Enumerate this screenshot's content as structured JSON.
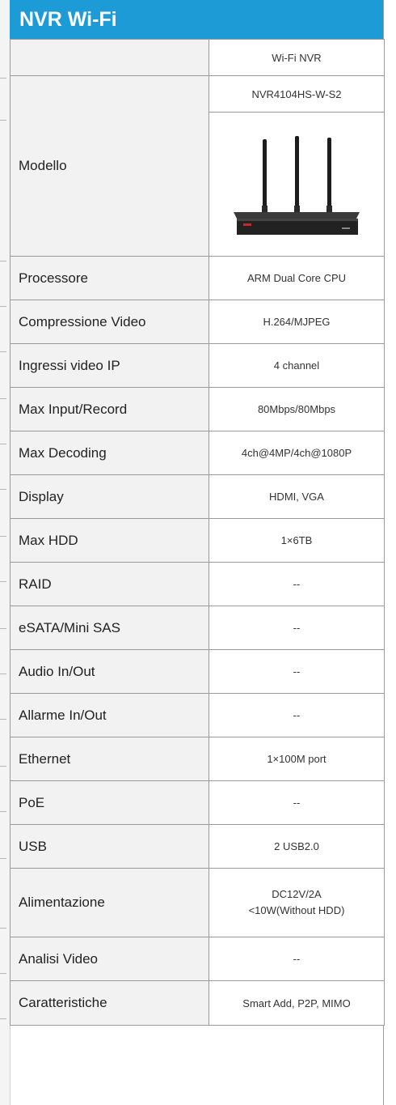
{
  "title": "NVR Wi-Fi",
  "column_header": "Wi-Fi NVR",
  "model_label": "Modello",
  "model_name": "NVR4104HS-W-S2",
  "rows": [
    {
      "label": "Processore",
      "value": "ARM Dual Core CPU"
    },
    {
      "label": "Compressione Video",
      "value": "H.264/MJPEG"
    },
    {
      "label": "Ingressi video IP",
      "value": "4 channel"
    },
    {
      "label": "Max Input/Record",
      "value": "80Mbps/80Mbps"
    },
    {
      "label": "Max Decoding",
      "value": "4ch@4MP/4ch@1080P"
    },
    {
      "label": "Display",
      "value": "HDMI, VGA"
    },
    {
      "label": "Max HDD",
      "value": "1×6TB"
    },
    {
      "label": "RAID",
      "value": "--"
    },
    {
      "label": "eSATA/Mini SAS",
      "value": "--"
    },
    {
      "label": "Audio In/Out",
      "value": "--"
    },
    {
      "label": "Allarme In/Out",
      "value": "--"
    },
    {
      "label": "Ethernet",
      "value": "1×100M port"
    },
    {
      "label": "PoE",
      "value": "--"
    },
    {
      "label": "USB",
      "value": "2 USB2.0"
    },
    {
      "label": "Alimentazione",
      "value_lines": [
        "DC12V/2A",
        "<10W(Without HDD)"
      ]
    },
    {
      "label": "Analisi Video",
      "value": "--"
    },
    {
      "label": "Caratteristiche",
      "value": "Smart Add, P2P, MIMO"
    }
  ],
  "colors": {
    "header_bg": "#1d9bd6",
    "header_text": "#ffffff",
    "label_bg": "#f2f2f2",
    "accent_text": "#1d9bd6"
  }
}
